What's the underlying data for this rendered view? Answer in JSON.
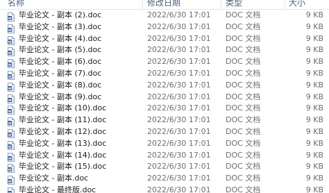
{
  "columns": {
    "name": "名称",
    "date": "修改日期",
    "type": "类型",
    "size": "大小"
  },
  "files": [
    {
      "name": "毕业论文 - 副本 (2).doc",
      "date": "2022/6/30 17:01",
      "type": "DOC 文档",
      "size": "9 KB",
      "icon": "word-document-icon"
    },
    {
      "name": "毕业论文 - 副本 (3).doc",
      "date": "2022/6/30 17:01",
      "type": "DOC 文档",
      "size": "9 KB",
      "icon": "word-document-icon"
    },
    {
      "name": "毕业论文 - 副本 (4).doc",
      "date": "2022/6/30 17:01",
      "type": "DOC 文档",
      "size": "9 KB",
      "icon": "word-document-icon"
    },
    {
      "name": "毕业论文 - 副本 (5).doc",
      "date": "2022/6/30 17:01",
      "type": "DOC 文档",
      "size": "9 KB",
      "icon": "word-document-icon"
    },
    {
      "name": "毕业论文 - 副本 (6).doc",
      "date": "2022/6/30 17:01",
      "type": "DOC 文档",
      "size": "9 KB",
      "icon": "word-document-icon"
    },
    {
      "name": "毕业论文 - 副本 (7).doc",
      "date": "2022/6/30 17:01",
      "type": "DOC 文档",
      "size": "9 KB",
      "icon": "word-document-icon"
    },
    {
      "name": "毕业论文 - 副本 (8).doc",
      "date": "2022/6/30 17:01",
      "type": "DOC 文档",
      "size": "9 KB",
      "icon": "word-document-icon"
    },
    {
      "name": "毕业论文 - 副本 (9).doc",
      "date": "2022/6/30 17:01",
      "type": "DOC 文档",
      "size": "9 KB",
      "icon": "word-document-icon"
    },
    {
      "name": "毕业论文 - 副本 (10).doc",
      "date": "2022/6/30 17:01",
      "type": "DOC 文档",
      "size": "9 KB",
      "icon": "word-document-icon"
    },
    {
      "name": "毕业论文 - 副本 (11).doc",
      "date": "2022/6/30 17:01",
      "type": "DOC 文档",
      "size": "9 KB",
      "icon": "word-document-icon"
    },
    {
      "name": "毕业论文 - 副本 (12).doc",
      "date": "2022/6/30 17:01",
      "type": "DOC 文档",
      "size": "9 KB",
      "icon": "word-document-icon"
    },
    {
      "name": "毕业论文 - 副本 (13).doc",
      "date": "2022/6/30 17:01",
      "type": "DOC 文档",
      "size": "9 KB",
      "icon": "word-document-icon"
    },
    {
      "name": "毕业论文 - 副本 (14).doc",
      "date": "2022/6/30 17:01",
      "type": "DOC 文档",
      "size": "9 KB",
      "icon": "word-document-icon"
    },
    {
      "name": "毕业论文 - 副本 (15).doc",
      "date": "2022/6/30 17:01",
      "type": "DOC 文档",
      "size": "9 KB",
      "icon": "word-document-icon"
    },
    {
      "name": "毕业论文 - 副本.doc",
      "date": "2022/6/30 17:01",
      "type": "DOC 文档",
      "size": "9 KB",
      "icon": "word-document-icon"
    },
    {
      "name": "毕业论文 - 最终版.doc",
      "date": "2022/6/30 17:01",
      "type": "DOC 文档",
      "size": "9 KB",
      "icon": "word-document-icon"
    }
  ],
  "colors": {
    "header_text": "#4c607a",
    "name_text": "#1b1b1b",
    "meta_text": "#6d6d6d",
    "icon_blue": "#2b579a"
  }
}
